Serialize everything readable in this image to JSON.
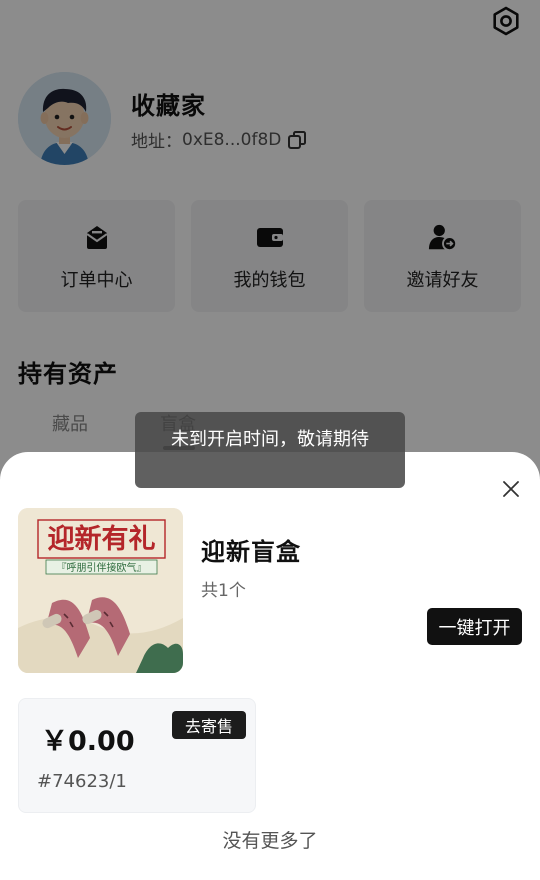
{
  "profile": {
    "username": "收藏家",
    "address_label": "地址：",
    "address_value": "0xE8...0f8D"
  },
  "quick_actions": [
    {
      "label": "订单中心",
      "icon": "order-mail-icon"
    },
    {
      "label": "我的钱包",
      "icon": "wallet-icon"
    },
    {
      "label": "邀请好友",
      "icon": "invite-user-icon"
    }
  ],
  "assets": {
    "title": "持有资产",
    "tabs": [
      {
        "label": "藏品",
        "active": false
      },
      {
        "label": "盲盒",
        "active": true
      }
    ]
  },
  "toast": {
    "message": "未到开启时间，敬请期待"
  },
  "sheet": {
    "box_title": "迎新盲盒",
    "count_text": "共1个",
    "open_all_label": "一键打开",
    "banner": {
      "headline": "迎新有礼",
      "tagline": "『呼朋引伴接欧气』"
    },
    "item": {
      "price": "￥0.00",
      "consign_label": "去寄售",
      "serial": "#74623/1"
    },
    "no_more_text": "没有更多了"
  },
  "colors": {
    "overlay": "rgba(0,0,0,0.45)",
    "button_dark": "#111111",
    "card_bg": "#f2f3f5",
    "banner_red": "#b4262a"
  }
}
